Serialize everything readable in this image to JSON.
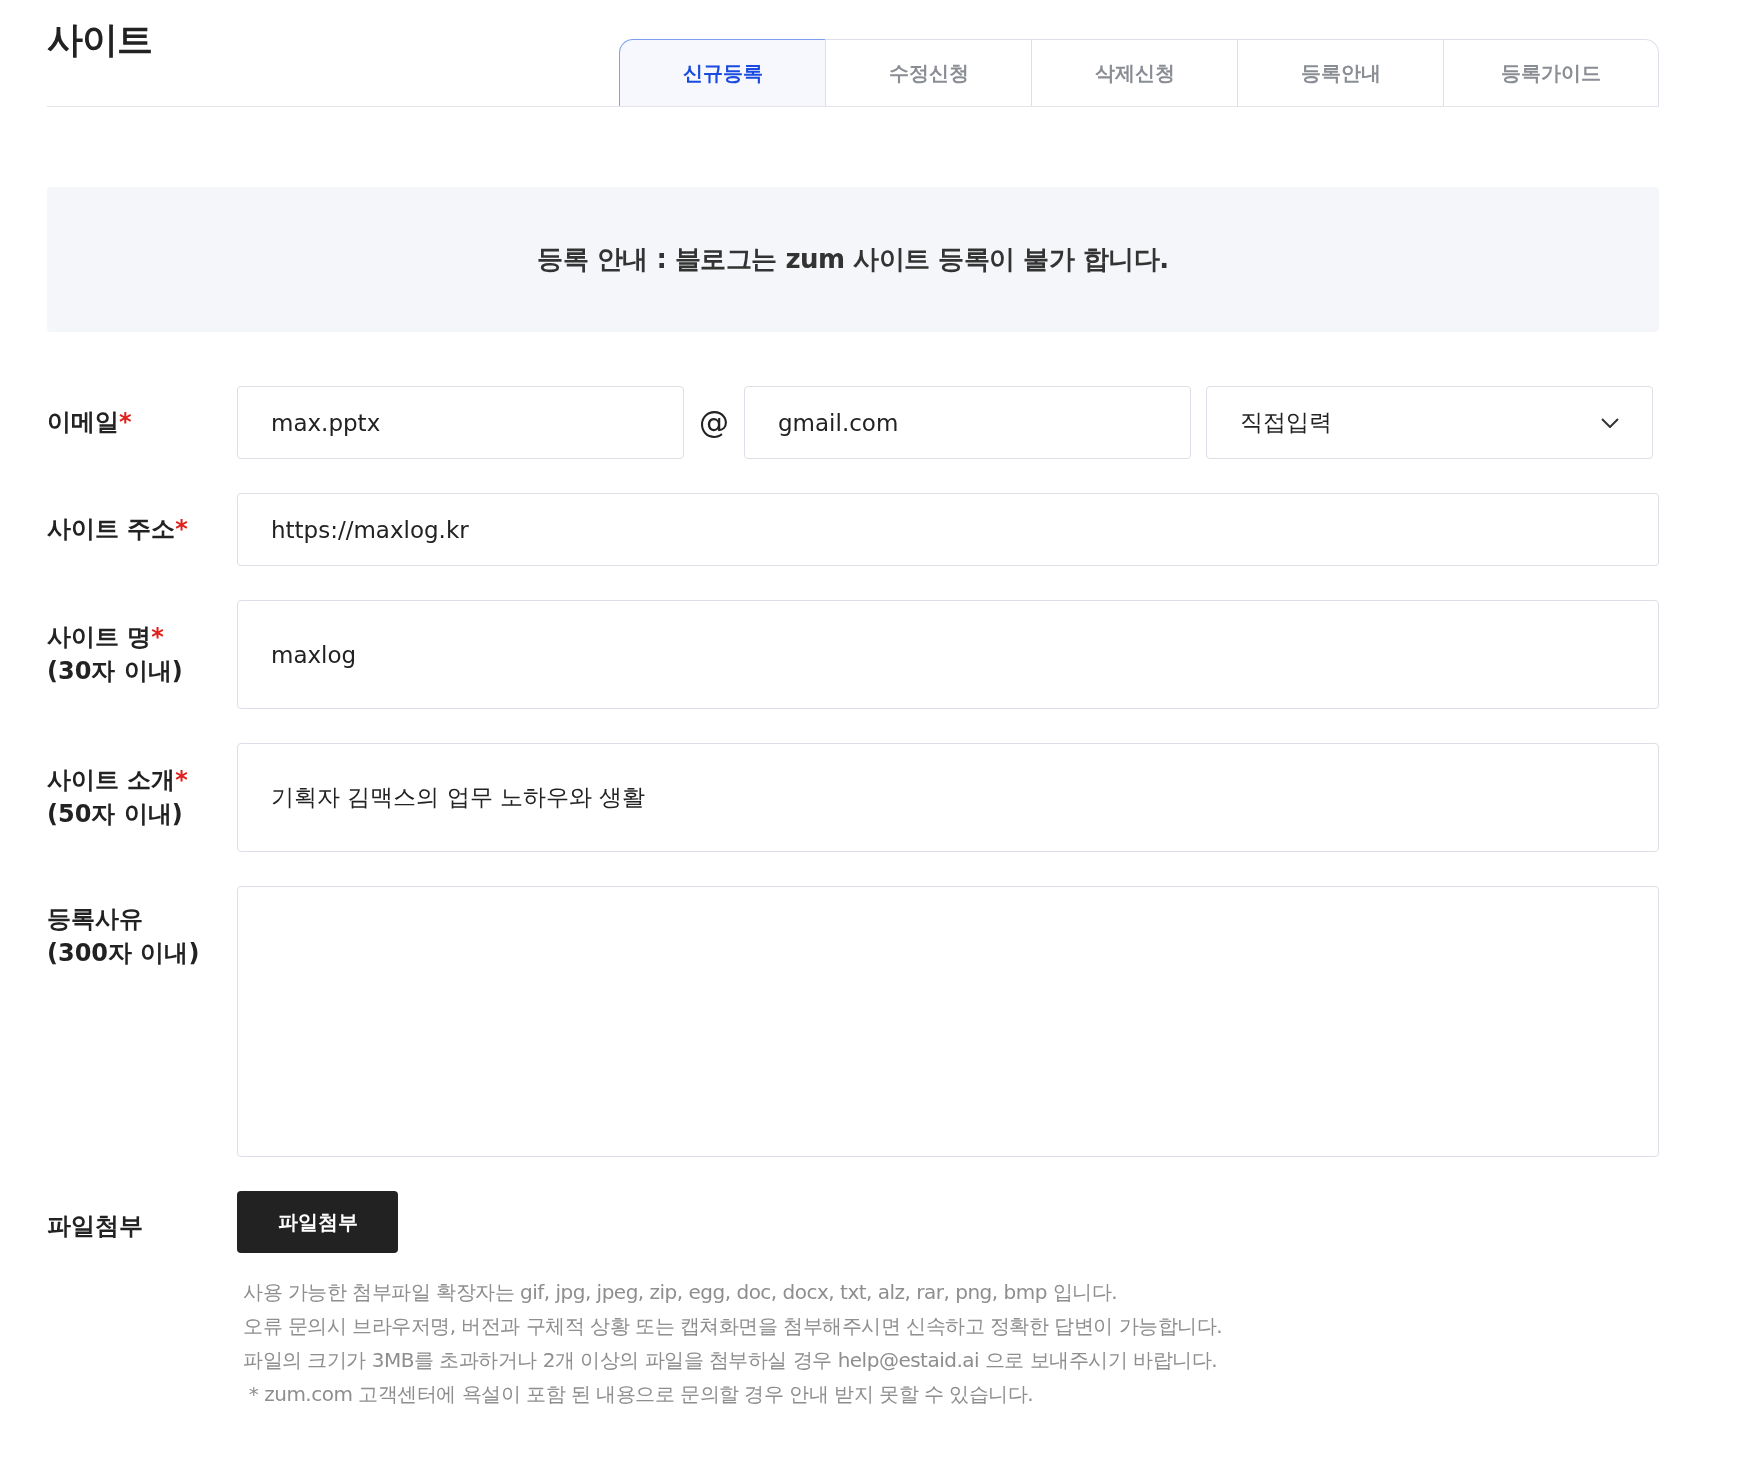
{
  "title": "사이트",
  "tabs": [
    {
      "label": "신규등록",
      "selected": true
    },
    {
      "label": "수정신청",
      "selected": false
    },
    {
      "label": "삭제신청",
      "selected": false
    },
    {
      "label": "등록안내",
      "selected": false
    },
    {
      "label": "등록가이드",
      "selected": false
    }
  ],
  "notice": "등록 안내 : 블로그는 zum 사이트 등록이 불가 합니다.",
  "fields": [
    {
      "kind": "email",
      "label": "이메일",
      "required_mark": "*",
      "local": "max.pptx",
      "at": "@",
      "domain": "gmail.com",
      "domain_select": "직접입력"
    },
    {
      "kind": "text",
      "label": "사이트 주소",
      "required_mark": "*",
      "value": "https://maxlog.kr"
    },
    {
      "kind": "text",
      "label": "사이트 명",
      "required_mark": "*",
      "limit": "(30자 이내)",
      "value": "maxlog"
    },
    {
      "kind": "text",
      "label": "사이트 소개",
      "required_mark": "*",
      "limit": "(50자 이내)",
      "value": "기획자 김맥스의 업무 노하우와 생활"
    },
    {
      "kind": "textarea",
      "label": "등록사유",
      "limit": "(300자 이내)"
    },
    {
      "kind": "file",
      "label": "파일첨부",
      "button": "파일첨부",
      "notes": [
        "사용 가능한 첨부파일 확장자는 gif, jpg, jpeg, zip, egg, doc, docx, txt, alz, rar, png, bmp 입니다.",
        "오류 문의시 브라우저명, 버전과 구체적 상황 또는 캡쳐화면을 첨부해주시면 신속하고 정확한 답변이 가능합니다.",
        "파일의 크기가 3MB를 초과하거나 2개 이상의 파일을 첨부하실 경우 help@estaid.ai 으로 보내주시기 바랍니다.",
        " * zum.com 고객센터에 욕설이 포함 된 내용으로 문의할 경우 안내 받지 못할 수 있습니다."
      ]
    }
  ]
}
